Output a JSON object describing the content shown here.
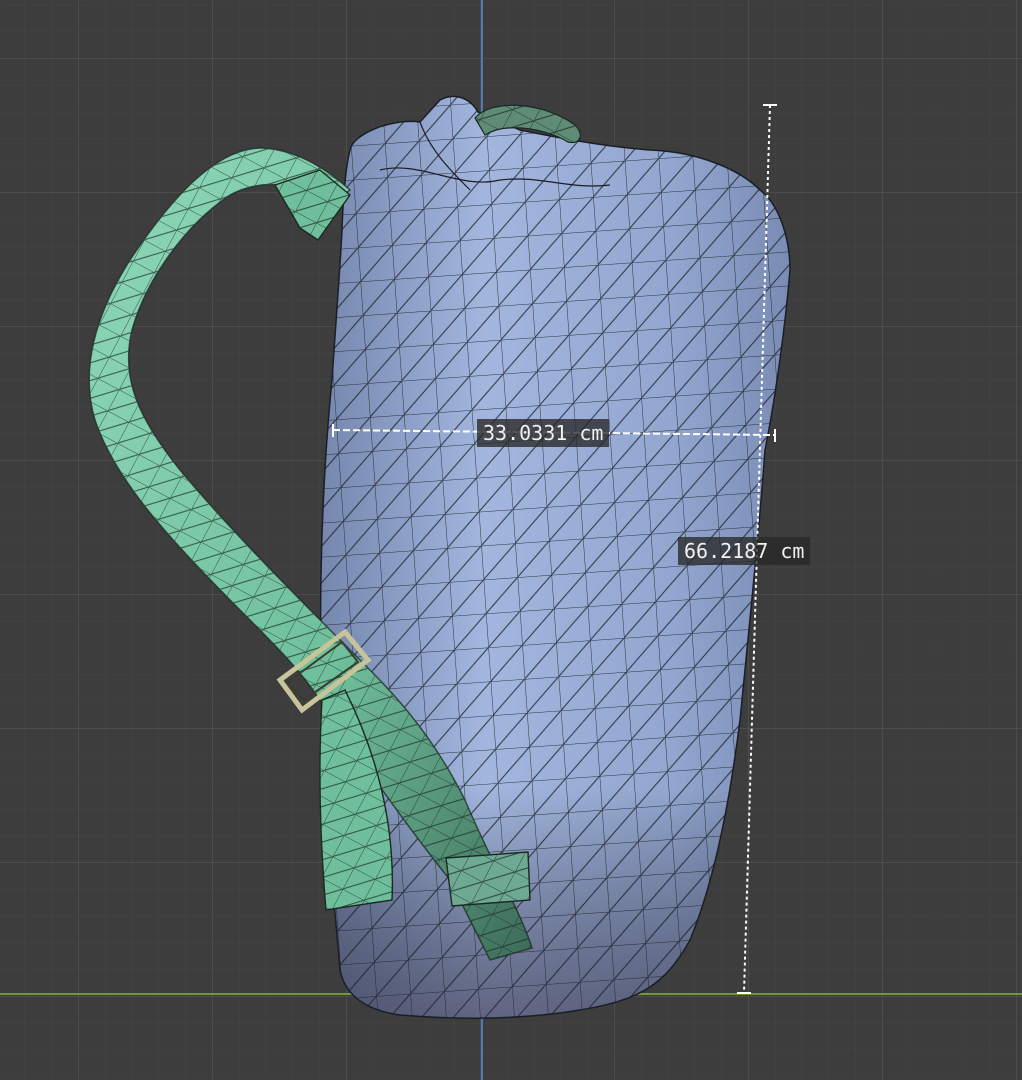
{
  "viewport": {
    "background_color": "#3d3d3d",
    "y_axis_color": "#4a7ab8",
    "x_axis_color": "#6f9a34"
  },
  "model": {
    "body_color": "#94a7cf",
    "strap_color": "#7ccaa8",
    "wire_color": "#1a1e26"
  },
  "measurements": {
    "width_label": "33.0331 cm",
    "height_label": "66.2187 cm"
  }
}
